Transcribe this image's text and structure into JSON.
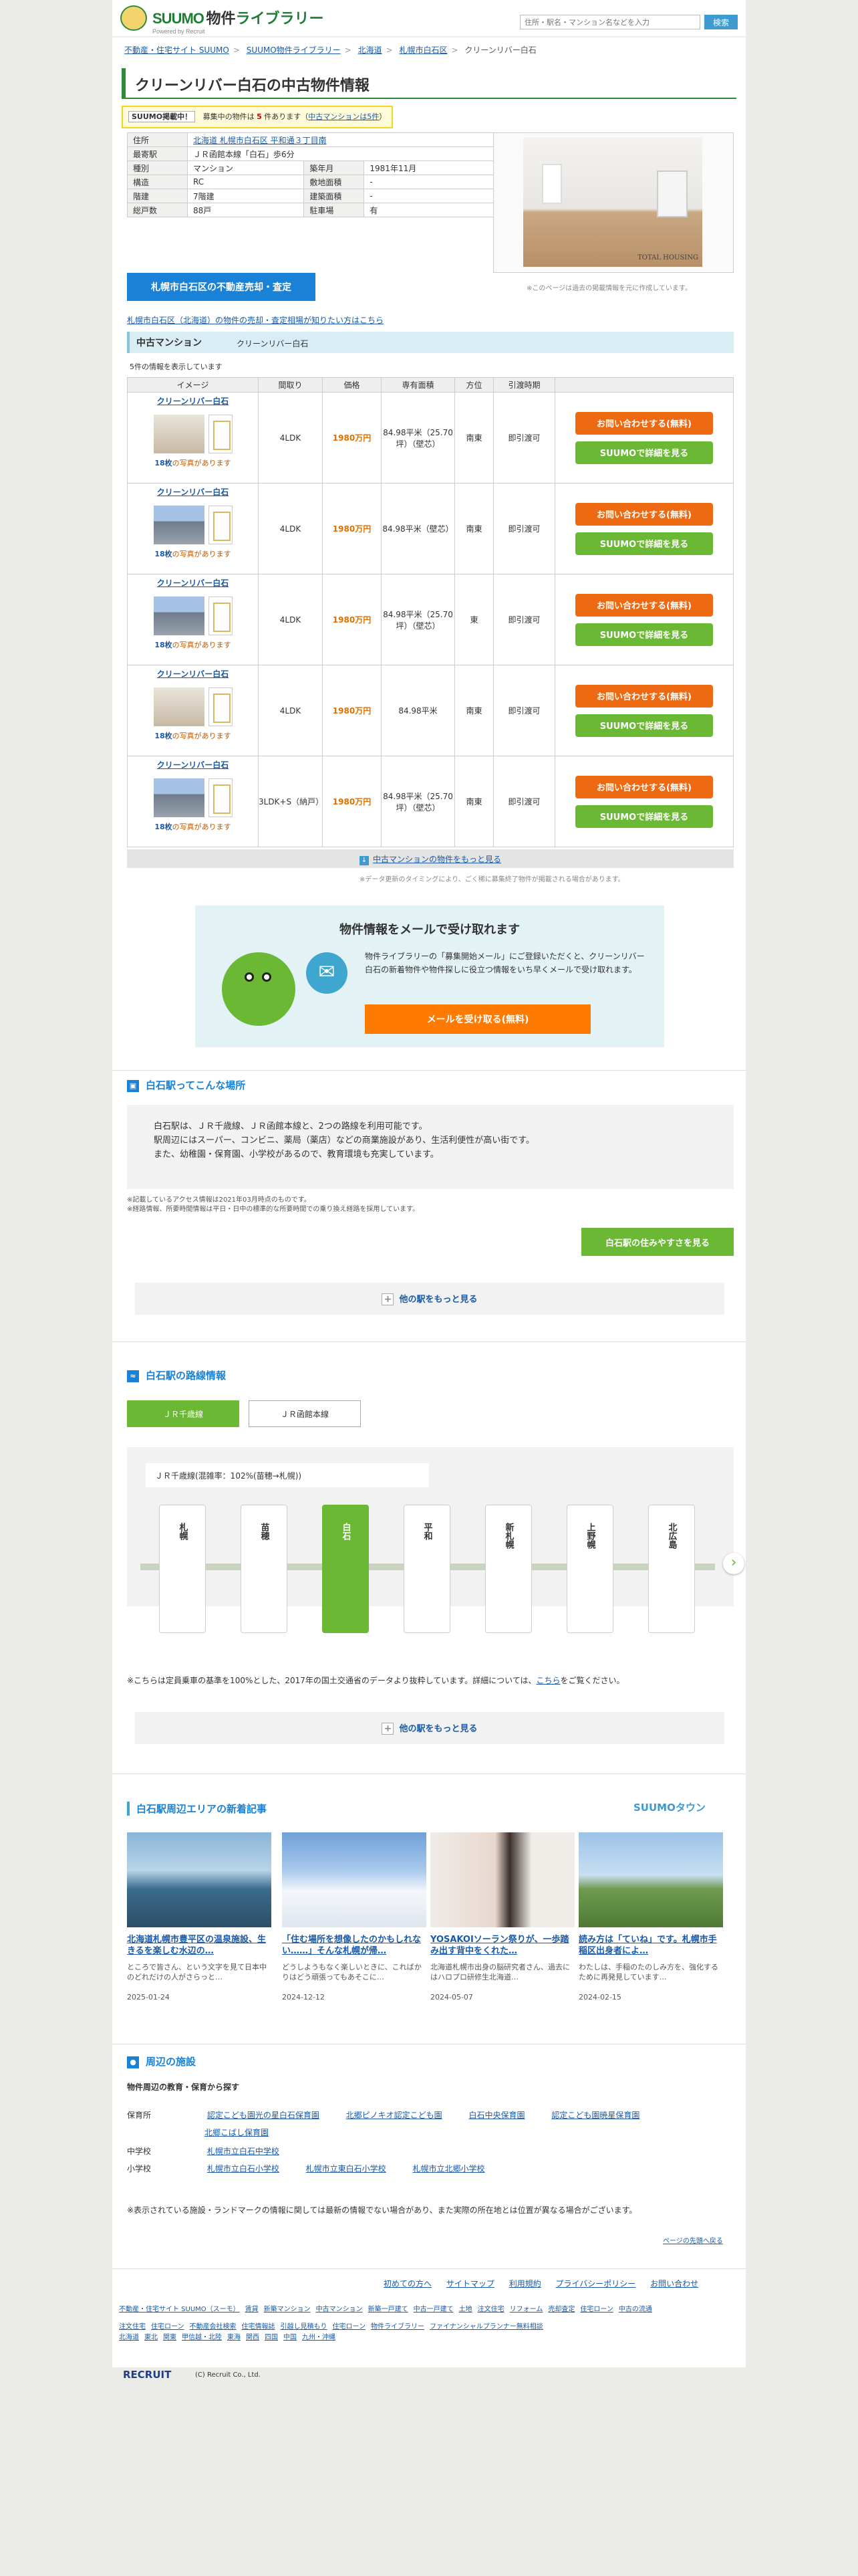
{
  "header": {
    "brand_a": "SUUMO",
    "brand_b": "物件",
    "brand_c": "ライブラリー",
    "brand_sub": "Powered by Recruit",
    "search_placeholder": "住所・駅名・マンション名などを入力",
    "search_btn": "検索"
  },
  "breadcrumb": [
    "不動産・住宅サイト SUUMO",
    "SUUMO物件ライブラリー",
    "北海道",
    "札幌市白石区",
    "クリーンリバー白石"
  ],
  "page_title": "クリーンリバー白石の中古物件情報",
  "notice": {
    "pill": "SUUMO掲載中！",
    "text1": "募集中の物件は",
    "count": "5",
    "text2": "件あります（",
    "link": "中古マンションは5件",
    "text3": "）"
  },
  "info": [
    [
      "住所",
      "北海道 札幌市白石区 平和通３丁目南",
      "",
      ""
    ],
    [
      "最寄駅",
      "ＪＲ函館本線「白石」歩6分",
      "",
      ""
    ],
    [
      "種別",
      "マンション",
      "築年月",
      "1981年11月"
    ],
    [
      "構造",
      "RC",
      "敷地面積",
      "-"
    ],
    [
      "階建",
      "7階建",
      "建築面積",
      "-"
    ],
    [
      "総戸数",
      "88戸",
      "駐車場",
      "有"
    ]
  ],
  "photo_tag": "TOTAL HOUSING",
  "photo_note": "※このページは過去の掲載情報を元に作成しています。",
  "sell_btn": "札幌市白石区の不動産売却・査定",
  "sell_link": "札幌市白石区（北海道）の物件の売却・査定相場が知りたい方はこちら",
  "listing": {
    "head": "中古マンション",
    "name": "クリーンリバー白石",
    "count_note": "5件の情報を表示しています",
    "columns": [
      "イメージ",
      "間取り",
      "価格",
      "専有面積",
      "方位",
      "引渡時期",
      ""
    ],
    "btn_inq": "お問い合わせする(無料)",
    "btn_det": "SUUMOで詳細を見る",
    "rows": [
      {
        "title": "クリーンリバー白石",
        "more_n": "18枚",
        "more_t": "の写真があります",
        "layout": "4LDK",
        "price": "1980万円",
        "area": "84.98平米（25.70坪）（壁芯）",
        "dir": "南東",
        "handover": "即引渡可"
      },
      {
        "title": "クリーンリバー白石",
        "more_n": "18枚",
        "more_t": "の写真があります",
        "layout": "4LDK",
        "price": "1980万円",
        "area": "84.98平米（壁芯）",
        "dir": "南東",
        "handover": "即引渡可"
      },
      {
        "title": "クリーンリバー白石",
        "more_n": "18枚",
        "more_t": "の写真があります",
        "layout": "4LDK",
        "price": "1980万円",
        "area": "84.98平米（25.70坪）（壁芯）",
        "dir": "東",
        "handover": "即引渡可"
      },
      {
        "title": "クリーンリバー白石",
        "more_n": "18枚",
        "more_t": "の写真があります",
        "layout": "4LDK",
        "price": "1980万円",
        "area": "84.98平米",
        "dir": "南東",
        "handover": "即引渡可"
      },
      {
        "title": "クリーンリバー白石",
        "more_n": "18枚",
        "more_t": "の写真があります",
        "layout": "3LDK+S（納戸）",
        "price": "1980万円",
        "area": "84.98平米（25.70坪）（壁芯）",
        "dir": "南東",
        "handover": "即引渡可"
      }
    ],
    "more": "中古マンションの物件をもっと見る",
    "update_note": "※データ更新のタイミングにより、ごく稀に募集終了物件が掲載される場合があります。"
  },
  "mail": {
    "title": "物件情報をメールで受け取れます",
    "text": "物件ライブラリーの「募集開始メール」にご登録いただくと、クリーンリバー白石の新着物件や物件探しに役立つ情報をいち早くメールで受け取れます。",
    "btn": "メールを受け取る(無料)"
  },
  "about": {
    "head": "白石駅ってこんな場所",
    "l1": "白石駅は、ＪＲ千歳線、ＪＲ函館本線と、2つの路線を利用可能です。",
    "l2": "駅周辺にはスーパー、コンビニ、薬局（薬店）などの商業施設があり、生活利便性が高い街です。",
    "l3": "また、幼稚園・保育園、小学校があるので、教育環境も充実しています。",
    "n1": "※記載しているアクセス情報は2021年03月時点のものです。",
    "n2": "※経路情報、所要時間情報は平日・日中の標準的な所要時間での乗り換え経路を採用しています。",
    "btn": "白石駅の住みやすさを見る",
    "more": "他の駅をもっと見る"
  },
  "lines": {
    "head": "白石駅の路線情報",
    "tab1": "ＪＲ千歳線",
    "tab2": "ＪＲ函館本線",
    "caption": "ＪＲ千歳線(混雑率：102%(苗穂→札幌))",
    "stations": [
      "札幌",
      "苗穂",
      "白石",
      "平和",
      "新札幌",
      "上野幌",
      "北広島"
    ],
    "note_a": "※こちらは定員乗車の基準を100%とした、2017年の国土交通省のデータより抜粋しています。詳細については、",
    "note_link": "こちら",
    "note_b": "をご覧ください。",
    "more": "他の駅をもっと見る"
  },
  "articles": {
    "head": "白石駅周辺エリアの新着記事",
    "logo": "SUUMOタウン",
    "items": [
      {
        "title": "北海道札幌市豊平区の温泉施設、生きるを楽しむ水辺の…",
        "desc": "ところで皆さん、という文字を見て日本中のどれだけの人がさらっと…",
        "date": "2025-01-24"
      },
      {
        "title": "「住む場所を想像したのかもしれない……」そんな札幌が帰…",
        "desc": "どうしようもなく楽しいときに、こればかりはどう頑張ってもあそこに…",
        "date": "2024-12-12"
      },
      {
        "title": "YOSAKOIソーラン祭りが、一歩踏み出す背中をくれた…",
        "desc": "北海道札幌市出身の脳研究者さん、過去にはハロプロ研修生北海道…",
        "date": "2024-05-07"
      },
      {
        "title": "読み方は「ていね」です。札幌市手稲区出身者によ…",
        "desc": "わたしは、手稲のたのしみ方を、強化するために再発見しています…",
        "date": "2024-02-15"
      }
    ]
  },
  "facilities": {
    "head": "周辺の施設",
    "sub": "物件周辺の教育・保育から探す",
    "nursery_k": "保育所",
    "nursery": [
      "認定こども園光の星白石保育園",
      "北郷ピノキオ認定こども園",
      "白石中央保育園",
      "認定こども園暁星保育園",
      "北郷こばし保育園"
    ],
    "junior_k": "中学校",
    "junior": [
      "札幌市立白石中学校"
    ],
    "elem_k": "小学校",
    "elem": [
      "札幌市立白石小学校",
      "札幌市立東白石小学校",
      "札幌市立北郷小学校"
    ],
    "note": "※表示されている施設・ランドマークの情報に関しては最新の情報でない場合があり、また実際の所在地とは位置が異なる場合がございます。"
  },
  "top_link": "ページの先頭へ戻る",
  "footer": {
    "nav": [
      "初めての方へ",
      "サイトマップ",
      "利用規約",
      "プライバシーポリシー",
      "お問い合わせ"
    ],
    "links1": [
      "不動産・住宅サイト SUUMO（スーモ）",
      "賃貸",
      "新築マンション",
      "中古マンション",
      "新築一戸建て",
      "中古一戸建て",
      "土地",
      "注文住宅",
      "リフォーム",
      "売却査定",
      "住宅ローン",
      "中古の流通"
    ],
    "links2": [
      "注文住宅",
      "住宅ローン",
      "不動産会社検索",
      "住宅情報誌",
      "引越し見積もり",
      "住宅ローン",
      "物件ライブラリー",
      "ファイナンシャルプランナー無料相談"
    ],
    "regions": [
      "北海道",
      "東北",
      "関東",
      "甲信越・北陸",
      "東海",
      "関西",
      "四国",
      "中国",
      "九州・沖縄"
    ],
    "brand": "RECRUIT",
    "copy": "(C) Recruit Co., Ltd."
  }
}
